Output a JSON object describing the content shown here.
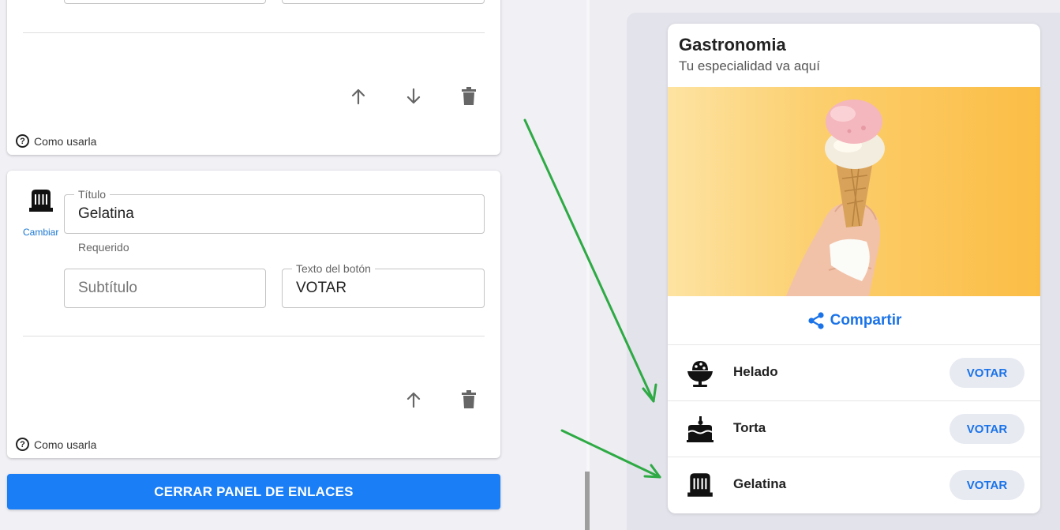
{
  "editor": {
    "card1": {
      "help_text": "Como usarla"
    },
    "card2": {
      "change_label": "Cambiar",
      "title_field": {
        "label": "Título",
        "value": "Gelatina",
        "helper": "Requerido"
      },
      "subtitle_field": {
        "placeholder": "Subtítulo"
      },
      "button_text_field": {
        "label": "Texto del botón",
        "value": "VOTAR"
      },
      "help_text": "Como usarla"
    },
    "close_button_label": "CERRAR PANEL DE ENLACES"
  },
  "preview": {
    "title": "Gastronomia",
    "subtitle": "Tu especialidad va aquí",
    "share_label": "Compartir",
    "links": [
      {
        "label": "Helado",
        "button": "VOTAR",
        "icon": "ice-cream-icon"
      },
      {
        "label": "Torta",
        "button": "VOTAR",
        "icon": "cake-icon"
      },
      {
        "label": "Gelatina",
        "button": "VOTAR",
        "icon": "jelly-icon"
      }
    ]
  },
  "colors": {
    "accent": "#1a7ef7",
    "link_blue": "#1a73e8",
    "annotation_arrow": "#2eaa44"
  }
}
